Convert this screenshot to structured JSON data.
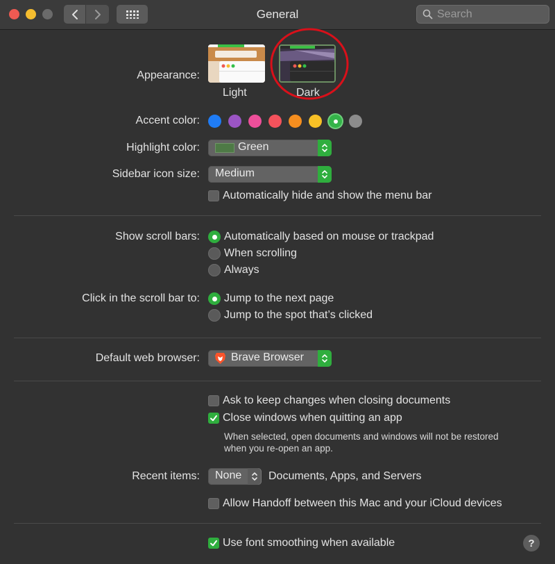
{
  "window": {
    "title": "General",
    "search_placeholder": "Search",
    "traffic_colors": {
      "close": "#ee5a52",
      "minimize": "#f5bd2f",
      "zoom": "#6b6b6b"
    }
  },
  "appearance": {
    "label": "Appearance:",
    "options": [
      {
        "name": "Light",
        "selected": false
      },
      {
        "name": "Dark",
        "selected": true
      }
    ],
    "highlight_circle_color": "#d9101a"
  },
  "accent": {
    "label": "Accent color:",
    "colors": [
      "#1f7cf5",
      "#9b55c4",
      "#ed4f9a",
      "#f4525c",
      "#f58e1f",
      "#f7c026",
      "#34b449",
      "#8c8c8c"
    ],
    "selected_index": 6
  },
  "highlight": {
    "label": "Highlight color:",
    "value": "Green",
    "swatch_color": "#4e7a46"
  },
  "sidebar_icon_size": {
    "label": "Sidebar icon size:",
    "value": "Medium"
  },
  "menu_bar": {
    "label": "Automatically hide and show the menu bar",
    "checked": false
  },
  "scroll_bars": {
    "label": "Show scroll bars:",
    "options": [
      "Automatically based on mouse or trackpad",
      "When scrolling",
      "Always"
    ],
    "selected_index": 0
  },
  "click_scroll": {
    "label": "Click in the scroll bar to:",
    "options": [
      "Jump to the next page",
      "Jump to the spot that’s clicked"
    ],
    "selected_index": 0
  },
  "browser": {
    "label": "Default web browser:",
    "value": "Brave Browser"
  },
  "documents": {
    "ask_keep": {
      "label": "Ask to keep changes when closing documents",
      "checked": false
    },
    "close_windows": {
      "label": "Close windows when quitting an app",
      "checked": true
    },
    "note_line1": "When selected, open documents and windows will not be restored",
    "note_line2": "when you re-open an app."
  },
  "recent": {
    "label": "Recent items:",
    "value": "None",
    "suffix": "Documents, Apps, and Servers"
  },
  "handoff": {
    "label": "Allow Handoff between this Mac and your iCloud devices",
    "checked": false
  },
  "font_smoothing": {
    "label": "Use font smoothing when available",
    "checked": true
  },
  "help": {
    "label": "?"
  }
}
